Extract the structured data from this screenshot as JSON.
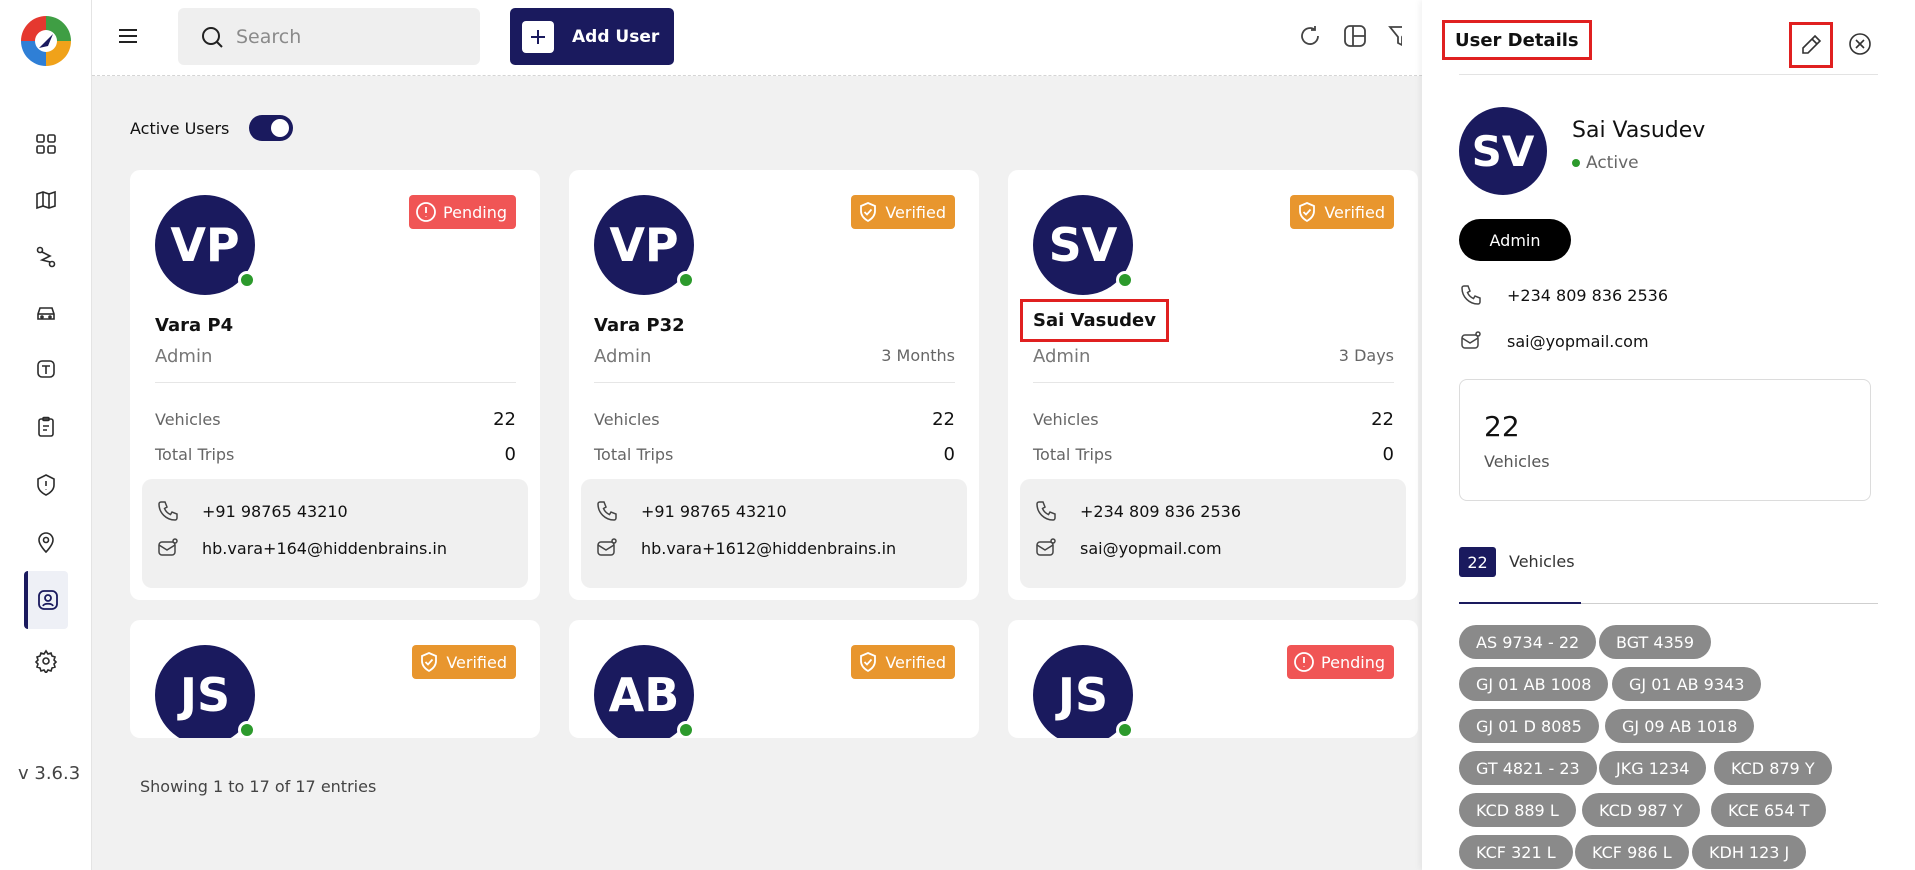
{
  "app": {
    "version": "v 3.6.3"
  },
  "topbar": {
    "search_placeholder": "Search",
    "add_user_label": "Add User"
  },
  "filters": {
    "active_users_label": "Active Users",
    "active_users_on": true
  },
  "cards": [
    {
      "initials": "VP",
      "name": "Vara P4",
      "role": "Admin",
      "duration": "",
      "status": "Pending",
      "vehicles_label": "Vehicles",
      "vehicles": "22",
      "trips_label": "Total Trips",
      "trips": "0",
      "phone": "+91 98765 43210",
      "email": "hb.vara+164@hiddenbrains.in"
    },
    {
      "initials": "VP",
      "name": "Vara P32",
      "role": "Admin",
      "duration": "3 Months",
      "status": "Verified",
      "vehicles_label": "Vehicles",
      "vehicles": "22",
      "trips_label": "Total Trips",
      "trips": "0",
      "phone": "+91 98765 43210",
      "email": "hb.vara+1612@hiddenbrains.in"
    },
    {
      "initials": "SV",
      "name": "Sai Vasudev",
      "role": "Admin",
      "duration": "3 Days",
      "status": "Verified",
      "vehicles_label": "Vehicles",
      "vehicles": "22",
      "trips_label": "Total Trips",
      "trips": "0",
      "phone": "+234 809 836 2536",
      "email": "sai@yopmail.com"
    },
    {
      "initials": "JS",
      "status": "Verified"
    },
    {
      "initials": "AB",
      "status": "Verified"
    },
    {
      "initials": "JS",
      "status": "Pending"
    }
  ],
  "footer": {
    "entries_text": "Showing 1 to 17 of 17 entries"
  },
  "panel": {
    "title": "User Details",
    "initials": "SV",
    "name": "Sai Vasudev",
    "status": "Active",
    "role": "Admin",
    "phone": "+234 809 836 2536",
    "email": "sai@yopmail.com",
    "stat_value": "22",
    "stat_label": "Vehicles",
    "tab_count": "22",
    "tab_label": "Vehicles",
    "vehicles": [
      "AS 9734 - 22",
      "BGT 4359",
      "GJ 01 AB 1008",
      "GJ 01 AB 9343",
      "GJ 01 D 8085",
      "GJ 09 AB 1018",
      "GT 4821 - 23",
      "JKG 1234",
      "KCD 879 Y",
      "KCD 889 L",
      "KCD 987 Y",
      "KCE 654 T",
      "KCF 321 L",
      "KCF 986 L",
      "KDH 123 J"
    ]
  },
  "colors": {
    "brand": "#1a1a5e",
    "pending": "#f05555",
    "verified": "#e8962e",
    "online": "#2c9a2c",
    "chip": "#8a8a8a",
    "highlight": "#e02020"
  }
}
